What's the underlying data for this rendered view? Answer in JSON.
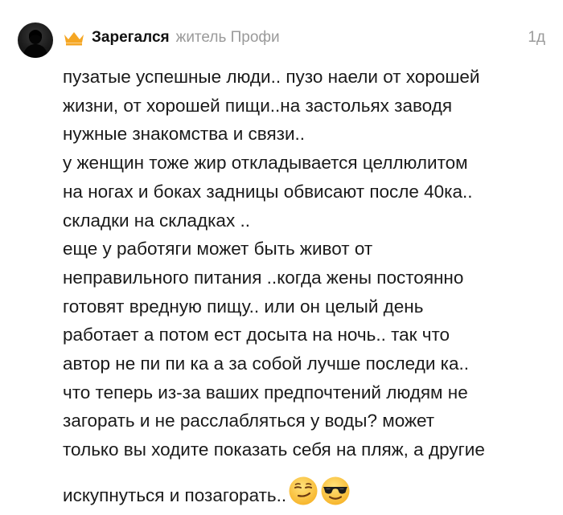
{
  "comment": {
    "author": "Зарегался",
    "status": "житель Профи",
    "time": "1д",
    "lines": [
      "пузатые успешные люди.. пузо наели от хорошей",
      "жизни, от хорошей пищи..на застольях заводя",
      "нужные знакомства и связи..",
      "у женщин тоже жир откладывается целлюлитом",
      "на ногах и боках задницы обвисают после 40ка..",
      "складки на складках ..",
      "еще у работяги может быть живот от",
      "неправильного питания ..когда жены постоянно",
      "готовят вредную пищу.. или он целый день",
      "работает а потом ест досыта на ночь.. так что",
      "автор не пи пи ка а за собой лучше последи ка..",
      "что теперь из-за ваших предпочтений людям не",
      "загорать и не расслабляться у воды? может",
      "только вы ходите показать себя на пляж, а другие"
    ],
    "last_line": "искупнуться и позагорать..",
    "icons": {
      "avatar": "avatar-silhouette",
      "badge": "crown-icon",
      "emoji_1": "smirking-face-emoji",
      "emoji_2": "sunglasses-face-emoji"
    },
    "colors": {
      "crown": "#F5A623",
      "text": "#1a1a1a",
      "muted": "#9a9a9a",
      "emoji_yellow": "#FFC83D"
    }
  }
}
